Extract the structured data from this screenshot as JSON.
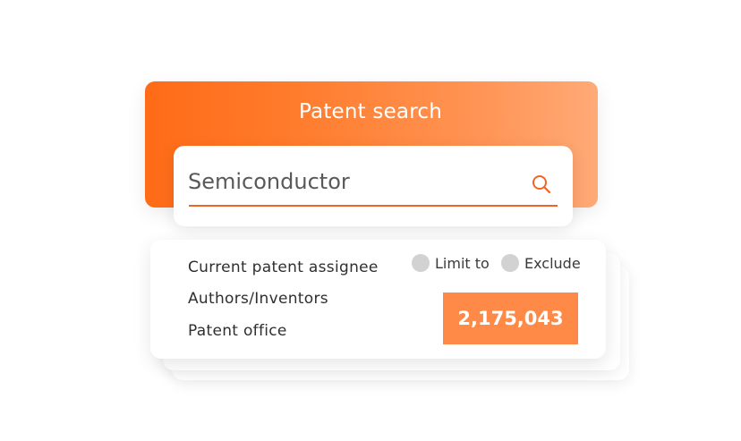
{
  "header": {
    "title": "Patent search"
  },
  "search": {
    "value": "Semiconductor",
    "icon": "search-icon"
  },
  "filters": {
    "labels": [
      "Current patent assignee",
      "Authors/Inventors",
      "Patent office"
    ],
    "options": [
      {
        "label": "Limit to",
        "selected": false
      },
      {
        "label": "Exclude",
        "selected": false
      }
    ]
  },
  "results": {
    "count": "2,175,043"
  },
  "colors": {
    "accent": "#f06524",
    "gradient_start": "#ff6b17",
    "gradient_end": "#ffaa77",
    "count_bg": "#ff8a47",
    "radio_off": "#d2d2d2"
  }
}
